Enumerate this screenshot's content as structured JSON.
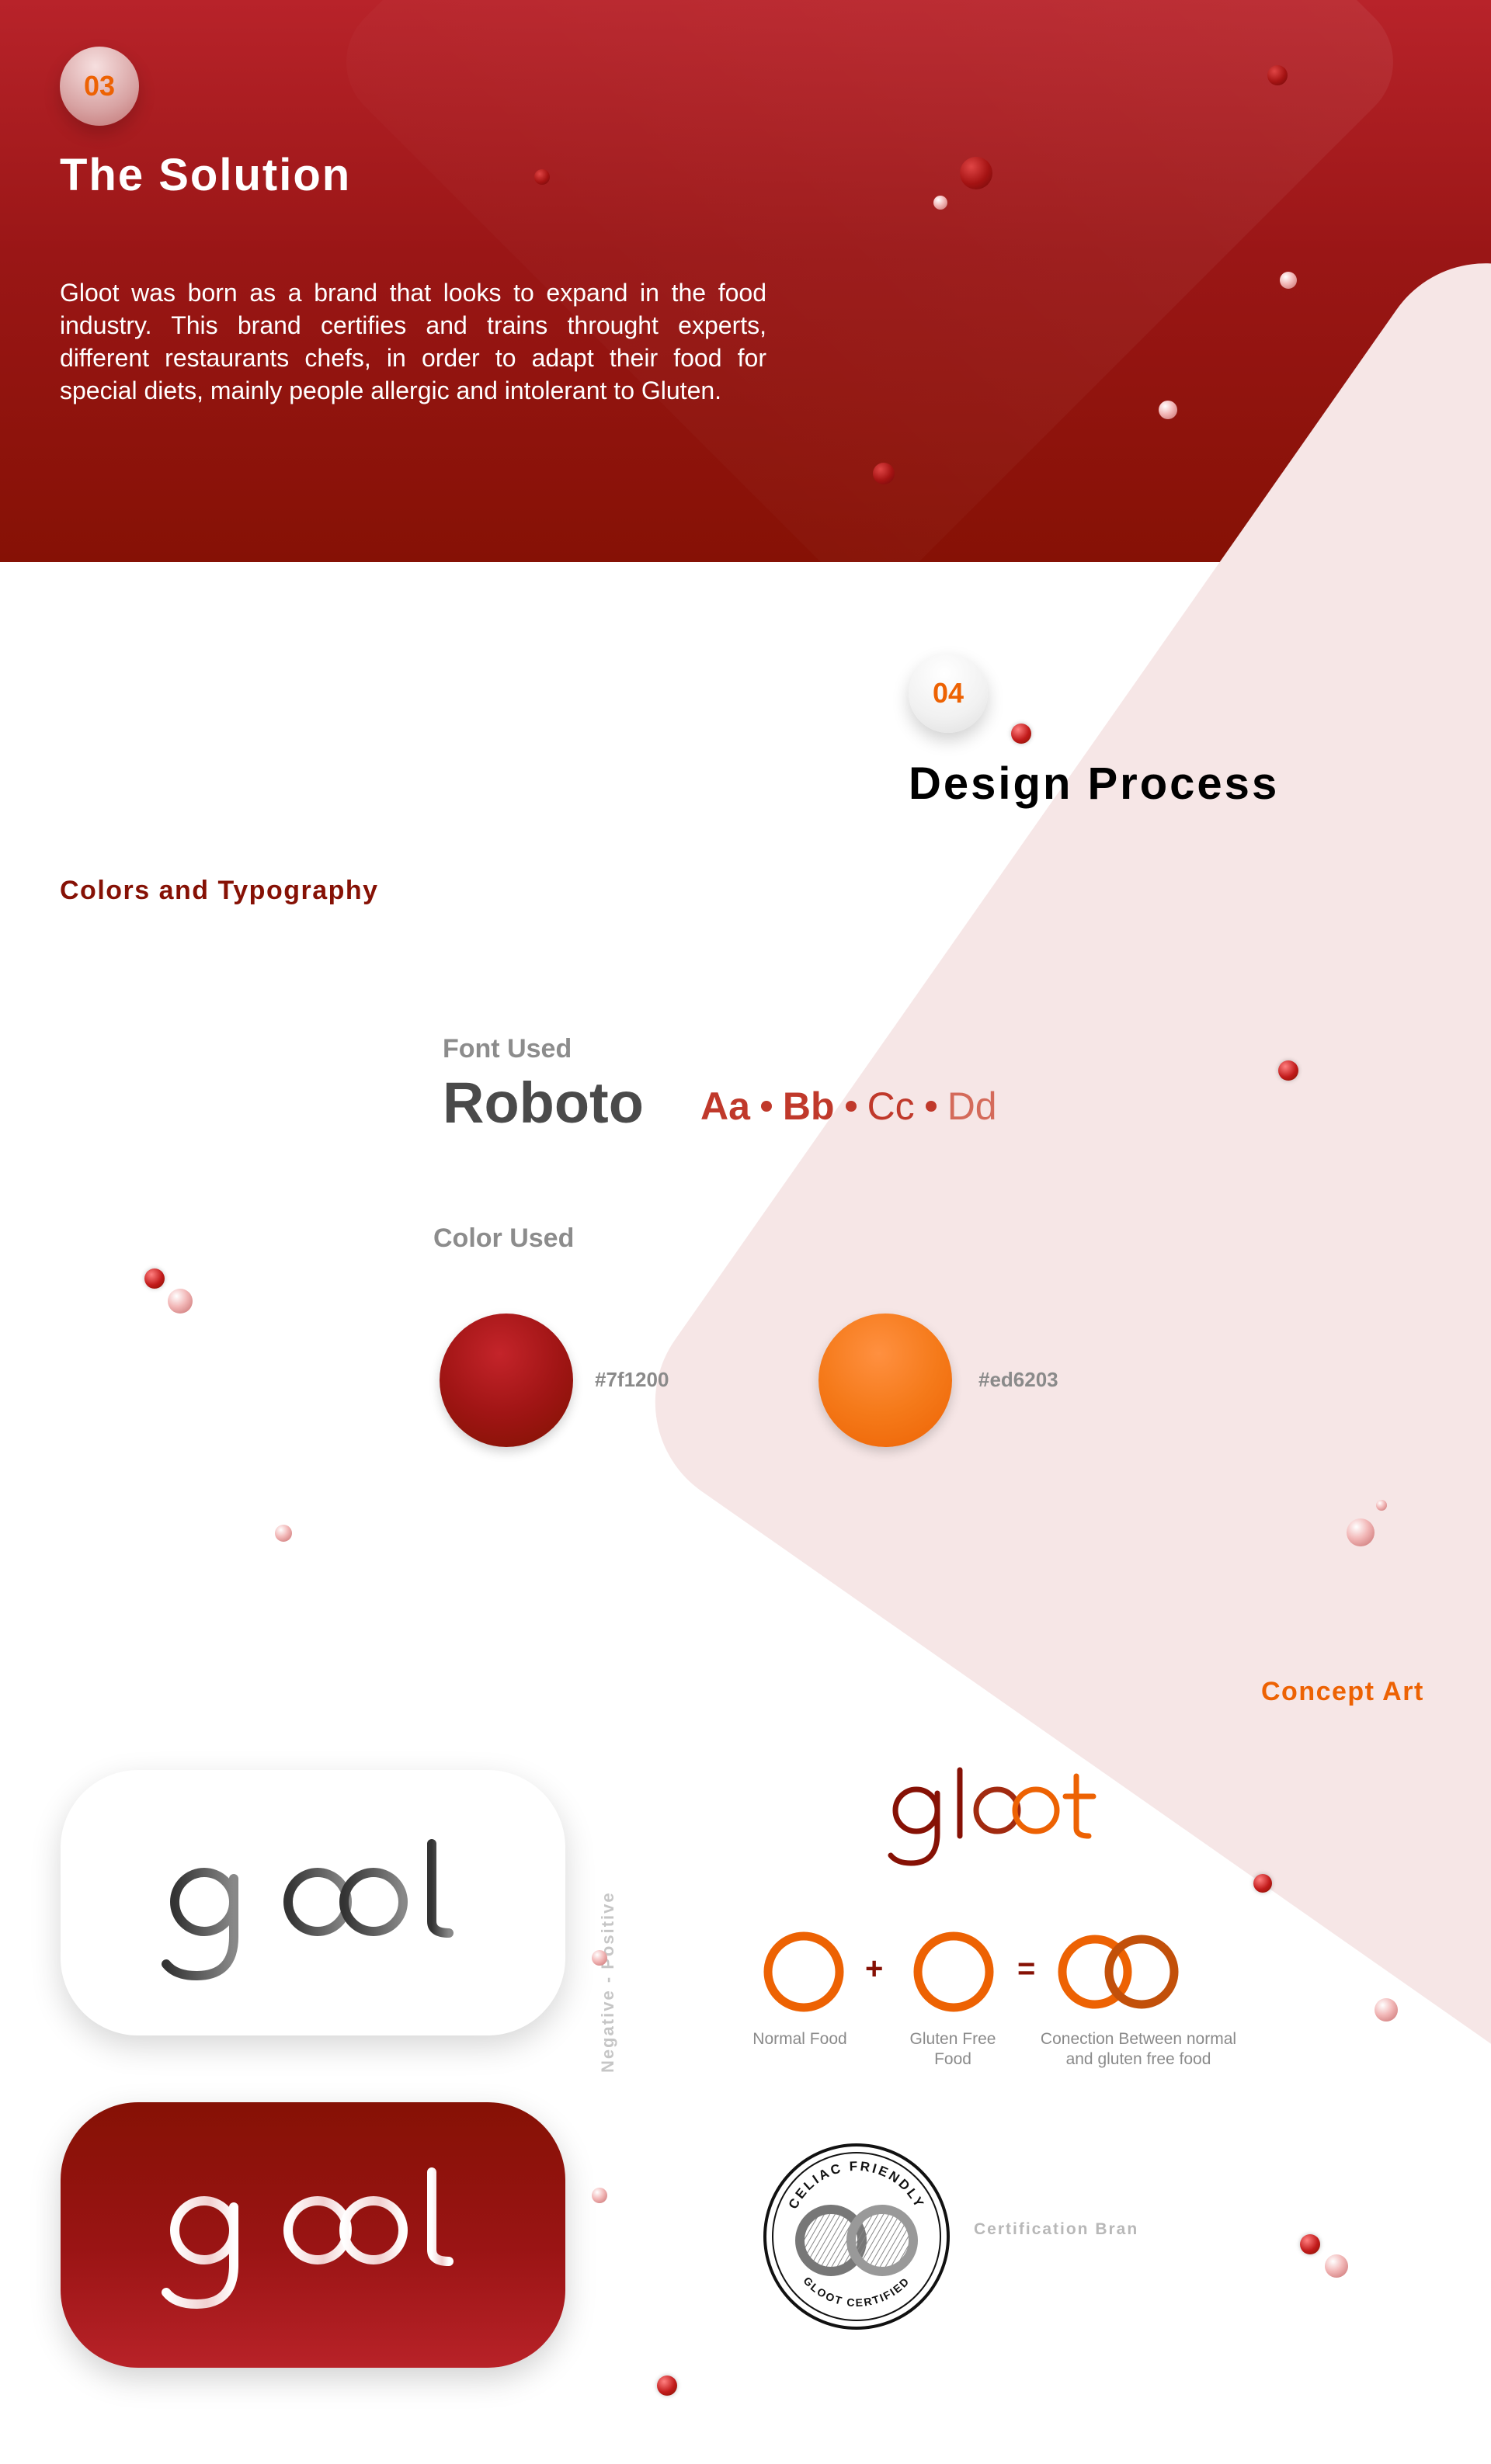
{
  "solution": {
    "number": "03",
    "title": "The Solution",
    "description": "Gloot was born as a brand that looks to expand in the food industry. This brand certifies and trains throught experts, different restaurants chefs, in order to adapt their food for special diets, mainly people allergic and intolerant to Gluten."
  },
  "design_process": {
    "number": "04",
    "title": "Design Process",
    "colors_typography_label": "Colors and Typography",
    "font": {
      "label": "Font Used",
      "name": "Roboto",
      "samples": [
        "Aa",
        "Bb",
        "Cc",
        "Dd"
      ]
    },
    "colors": {
      "label": "Color Used",
      "swatches": [
        {
          "hex": "#7f1200",
          "label": "#7f1200"
        },
        {
          "hex": "#ed6203",
          "label": "#ed6203"
        }
      ]
    }
  },
  "logos": {
    "wordmark_text": "gloot",
    "vertical_label": "Negative - Positive"
  },
  "concept_art": {
    "label": "Concept Art",
    "wordmark_text": "gloot",
    "equation": {
      "plus": "+",
      "equals": "=",
      "captions": [
        "Normal Food",
        "Gluten Free Food",
        "Conection Between normal and gluten free food"
      ]
    },
    "certification": {
      "top_text": "CELIAC FRIENDLY",
      "bottom_text": "GLOOT CERTIFIED",
      "label": "Certification Bran"
    }
  },
  "colors": {
    "primary_red": "#7f1200",
    "accent_orange": "#ed6203"
  }
}
